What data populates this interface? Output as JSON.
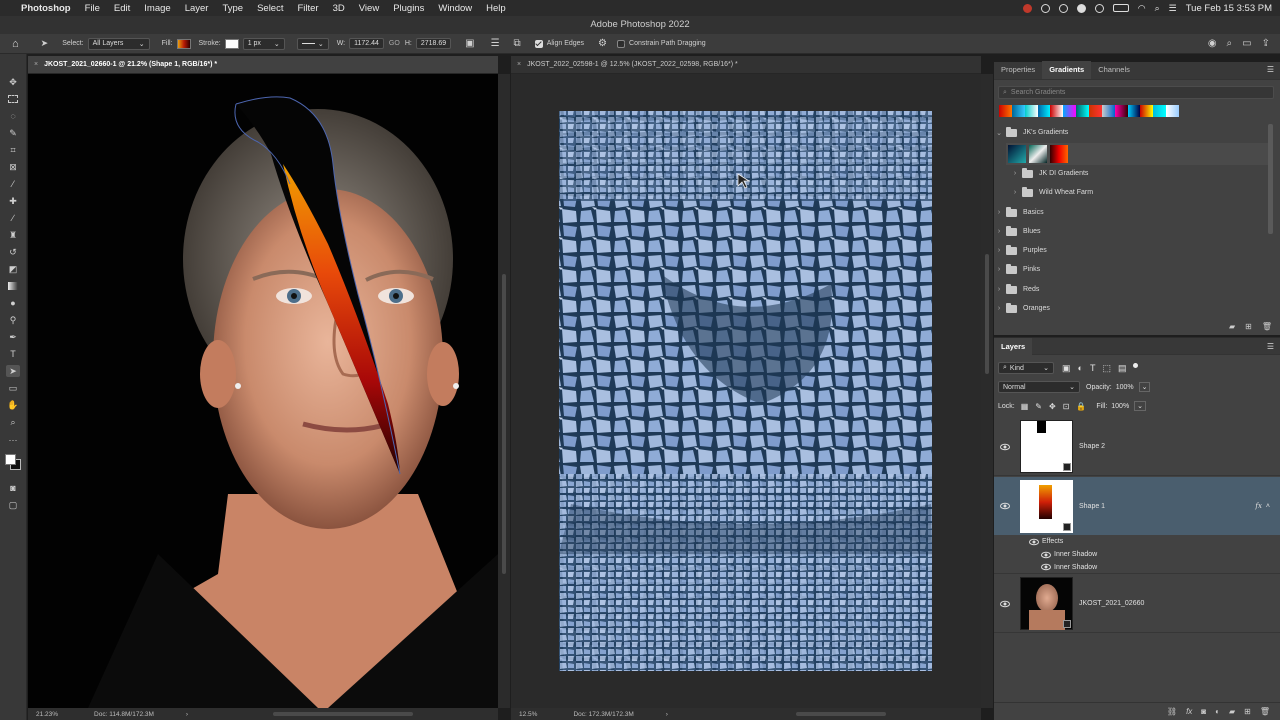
{
  "menubar": {
    "app": "Photoshop",
    "items": [
      "File",
      "Edit",
      "Image",
      "Layer",
      "Type",
      "Select",
      "Filter",
      "3D",
      "View",
      "Plugins",
      "Window",
      "Help"
    ],
    "clock": "Tue Feb 15  3:53 PM"
  },
  "titlebar": {
    "title": "Adobe Photoshop 2022"
  },
  "options": {
    "select_label": "Select:",
    "select_value": "All Layers",
    "fill_label": "Fill:",
    "stroke_label": "Stroke:",
    "stroke_width": "1 px",
    "w_label": "W:",
    "w_value": "1172.44",
    "go_label": "GO",
    "h_label": "H:",
    "h_value": "2718.69",
    "align_edges": "Align Edges",
    "constrain": "Constrain Path Dragging",
    "fill_color": "#b81a06"
  },
  "docs": {
    "left": {
      "tab": "JKOST_2021_02660-1 @ 21.2% (Shape 1, RGB/16*) *",
      "zoom": "21.23%",
      "doc": "Doc: 114.8M/172.3M"
    },
    "right": {
      "tab": "JKOST_2022_02598-1 @ 12.5% (JKOST_2022_02598, RGB/16*) *",
      "zoom": "12.5%",
      "doc": "Doc: 172.3M/172.3M"
    }
  },
  "panel_top": {
    "tabs": [
      "Properties",
      "Gradients",
      "Channels"
    ],
    "active_tab": "Gradients",
    "search_placeholder": "Search Gradients",
    "jk_folder": "JK's Gradients",
    "subfolders": [
      "JK DI Gradients",
      "Wild Wheat Farm"
    ],
    "folders": [
      "Basics",
      "Blues",
      "Purples",
      "Pinks",
      "Reds",
      "Oranges"
    ]
  },
  "layers": {
    "title": "Layers",
    "kind": "Kind",
    "blend": "Normal",
    "opacity_label": "Opacity:",
    "opacity": "100%",
    "lock_label": "Lock:",
    "fill_label": "Fill:",
    "fill": "100%",
    "items": [
      {
        "name": "Shape 2"
      },
      {
        "name": "Shape 1"
      },
      {
        "name": "JKOST_2021_02660"
      }
    ],
    "effects": "Effects",
    "effect_items": [
      "Inner Shadow",
      "Inner Shadow"
    ],
    "fx": "fx"
  },
  "colors": {
    "selected_layer": "#4a5e6e",
    "ice": "#8aa6cf"
  }
}
